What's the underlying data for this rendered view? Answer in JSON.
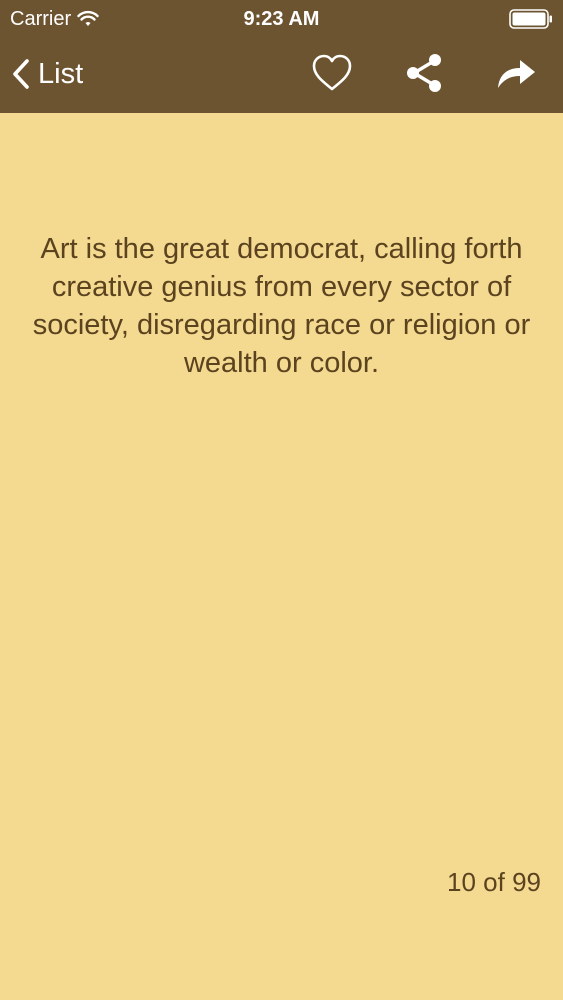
{
  "status_bar": {
    "carrier": "Carrier",
    "time": "9:23 AM",
    "wifi_icon": "wifi-icon",
    "battery_icon": "battery-full-icon"
  },
  "nav": {
    "back_label": "List",
    "icons": [
      "chevron-left-icon",
      "heart-icon",
      "share-icon",
      "forward-arrow-icon"
    ]
  },
  "quote": {
    "text": "Art is the great democrat, calling forth creative genius from every sector of society, disregarding race or religion or wealth or color."
  },
  "pager": {
    "text": "10 of 99"
  },
  "colors": {
    "background": "#f4d990",
    "bar": "#6d5430",
    "text": "#5b431f"
  }
}
